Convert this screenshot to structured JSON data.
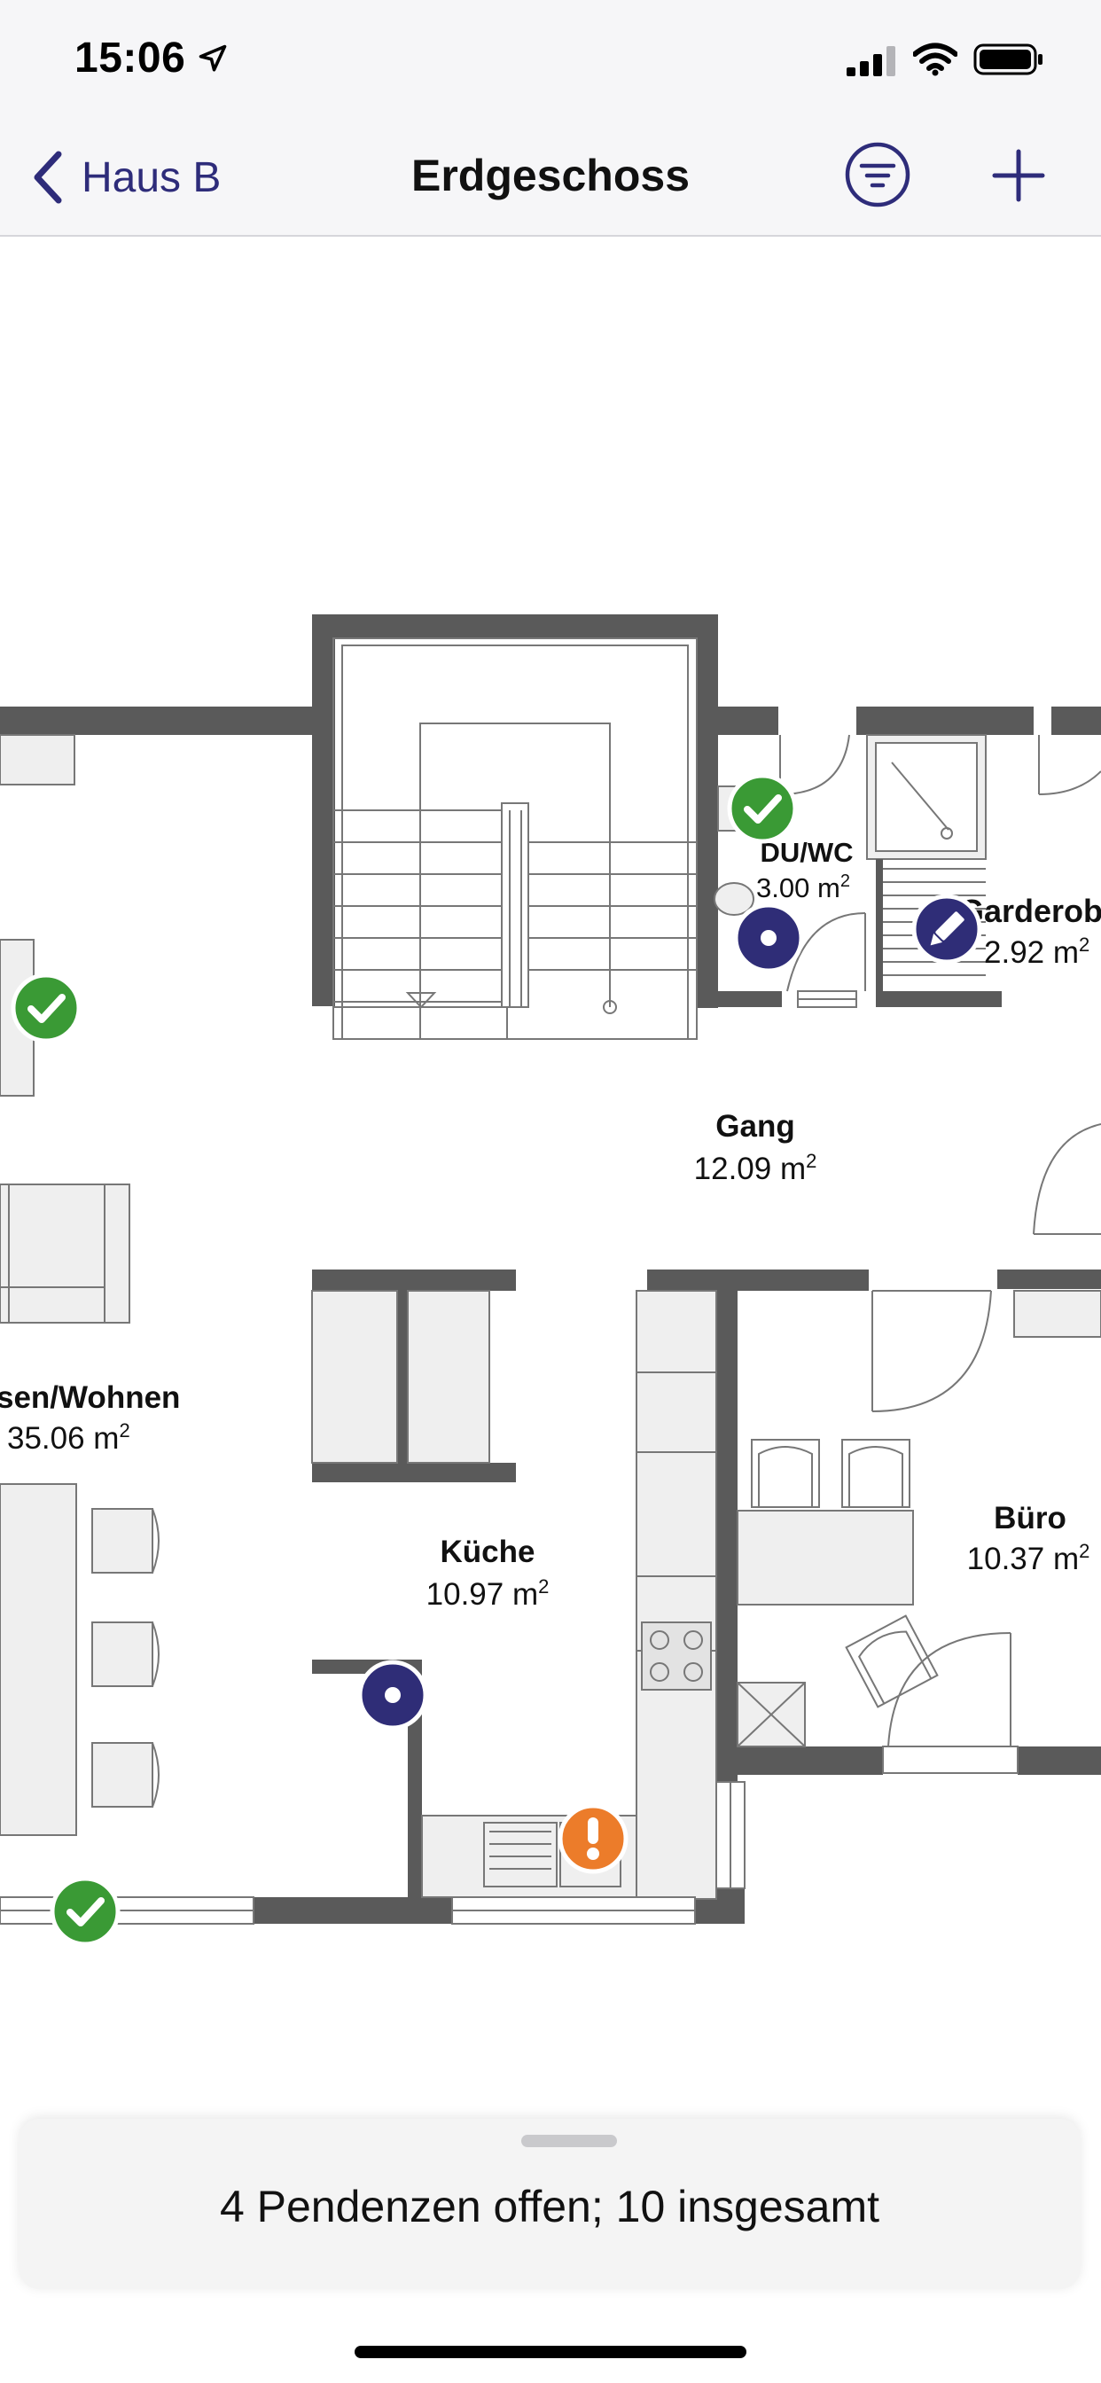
{
  "status_bar": {
    "time": "15:06"
  },
  "nav": {
    "back_label": "Haus B",
    "title": "Erdgeschoss"
  },
  "plan": {
    "rooms": [
      {
        "name": "DU/WC",
        "area": "3.00 m",
        "sup": "2"
      },
      {
        "name": "Garderob",
        "area": "2.92 m",
        "sup": "2"
      },
      {
        "name": "Gang",
        "area": "12.09 m",
        "sup": "2"
      },
      {
        "name": "sen/Wohnen",
        "area": "35.06 m",
        "sup": "2"
      },
      {
        "name": "Küche",
        "area": "10.97 m",
        "sup": "2"
      },
      {
        "name": "Büro",
        "area": "10.37 m",
        "sup": "2"
      }
    ],
    "markers": [
      {
        "type": "done",
        "color": "#3a9a35"
      },
      {
        "type": "done",
        "color": "#3a9a35"
      },
      {
        "type": "done",
        "color": "#3a9a35"
      },
      {
        "type": "open",
        "color": "#2f2d77"
      },
      {
        "type": "open",
        "color": "#2f2d77"
      },
      {
        "type": "edit",
        "color": "#2f2d77"
      },
      {
        "type": "warning",
        "color": "#ec7c2a"
      }
    ],
    "colors": {
      "wall": "#5a5a5a",
      "fixture": "#efefef",
      "line": "#777777"
    }
  },
  "bottom_sheet": {
    "summary": "4 Pendenzen offen; 10 insgesamt"
  }
}
